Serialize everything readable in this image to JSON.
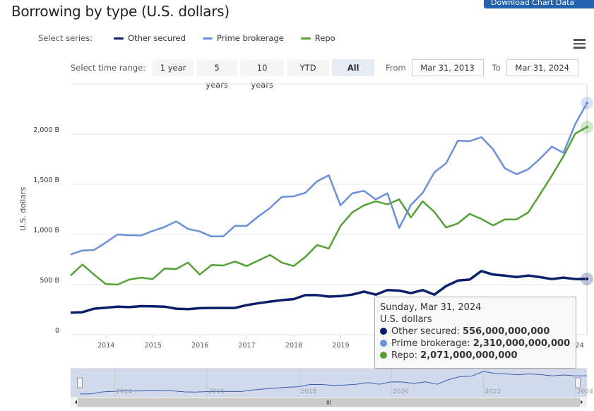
{
  "title": "Borrowing by type (U.S. dollars)",
  "download_button": "Download Chart Data",
  "legend": {
    "label": "Select series:",
    "items": [
      {
        "name": "Other secured",
        "color": "#0c1f6b"
      },
      {
        "name": "Prime brokerage",
        "color": "#6990d8"
      },
      {
        "name": "Repo",
        "color": "#55a035"
      }
    ]
  },
  "range_selector": {
    "label": "Select time range:",
    "buttons": [
      "1 year",
      "5 years",
      "10 years",
      "YTD",
      "All"
    ],
    "active": "All",
    "from_label": "From",
    "from_value": "Mar 31, 2013",
    "to_label": "To",
    "to_value": "Mar 31, 2024"
  },
  "tooltip": {
    "date": "Sunday, Mar 31, 2024",
    "unit": "U.S. dollars",
    "rows": [
      {
        "name": "Other secured",
        "value": "556,000,000,000",
        "color": "#0c1f6b"
      },
      {
        "name": "Prime brokerage",
        "value": "2,310,000,000,000",
        "color": "#6990d8"
      },
      {
        "name": "Repo",
        "value": "2,071,000,000,000",
        "color": "#55a035"
      }
    ]
  },
  "chart_data": {
    "type": "line",
    "title": "Borrowing by type (U.S. dollars)",
    "ylabel": "U.S. dollars",
    "xlabel": "",
    "x_start": "2013-03-31",
    "x_frequency": "quarterly",
    "x_end": "2024-03-31",
    "ylim": [
      0,
      2500
    ],
    "y_ticks": [
      0,
      500,
      1000,
      1500,
      2000
    ],
    "y_tick_labels": [
      "0",
      "500 B",
      "1,000 B",
      "1,500 B",
      "2,000 B"
    ],
    "x_tick_labels": [
      "2014",
      "2015",
      "2016",
      "2017",
      "2018",
      "2019",
      "2020",
      "2021",
      "2022",
      "2023",
      "2024"
    ],
    "navigator_tick_labels": [
      "2014",
      "2016",
      "2018",
      "2020",
      "2022",
      "2024"
    ],
    "grid": true,
    "unit": "billions of U.S. dollars",
    "series": [
      {
        "name": "Other secured",
        "color": "#0c1f6b",
        "values": [
          220,
          225,
          260,
          270,
          280,
          275,
          285,
          283,
          280,
          260,
          255,
          265,
          267,
          267,
          267,
          295,
          315,
          330,
          345,
          355,
          395,
          395,
          380,
          385,
          400,
          430,
          400,
          445,
          440,
          415,
          445,
          400,
          485,
          540,
          550,
          635,
          600,
          590,
          575,
          590,
          575,
          555,
          570,
          555,
          556
        ]
      },
      {
        "name": "Prime brokerage",
        "color": "#6990d8",
        "values": [
          800,
          840,
          845,
          920,
          1000,
          993,
          990,
          1035,
          1075,
          1130,
          1055,
          1030,
          980,
          980,
          1085,
          1085,
          1180,
          1265,
          1375,
          1380,
          1415,
          1530,
          1590,
          1290,
          1410,
          1435,
          1350,
          1410,
          1065,
          1295,
          1415,
          1620,
          1710,
          1935,
          1930,
          1970,
          1850,
          1660,
          1600,
          1650,
          1755,
          1875,
          1815,
          2100,
          2310
        ]
      },
      {
        "name": "Repo",
        "color": "#55a035",
        "values": [
          590,
          700,
          600,
          505,
          500,
          550,
          570,
          555,
          660,
          655,
          720,
          600,
          695,
          690,
          730,
          685,
          740,
          795,
          720,
          685,
          775,
          895,
          860,
          1085,
          1220,
          1290,
          1330,
          1300,
          1350,
          1170,
          1330,
          1225,
          1070,
          1110,
          1205,
          1155,
          1090,
          1150,
          1150,
          1220,
          1400,
          1585,
          1780,
          2005,
          2071
        ]
      }
    ]
  }
}
